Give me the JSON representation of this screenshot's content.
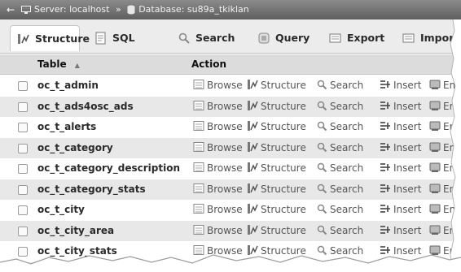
{
  "breadcrumb": {
    "back_glyph": "←",
    "server_label": "Server: localhost",
    "separator": "»",
    "database_label": "Database: su89a_tkiklan"
  },
  "tabs": [
    {
      "label": "Structure",
      "icon": "structure-icon",
      "active": true
    },
    {
      "label": "SQL",
      "icon": "sql-icon",
      "active": false
    },
    {
      "label": "Search",
      "icon": "search-icon",
      "active": false
    },
    {
      "label": "Query",
      "icon": "query-icon",
      "active": false
    },
    {
      "label": "Export",
      "icon": "export-icon",
      "active": false
    },
    {
      "label": "Import",
      "icon": "import-icon",
      "active": false
    }
  ],
  "table": {
    "headers": {
      "table": "Table",
      "sort_glyph": "▲",
      "action": "Action"
    },
    "actions": {
      "browse": "Browse",
      "structure": "Structure",
      "search": "Search",
      "insert": "Insert",
      "empty": "Empty"
    },
    "rows": [
      {
        "name": "oc_t_admin"
      },
      {
        "name": "oc_t_ads4osc_ads"
      },
      {
        "name": "oc_t_alerts"
      },
      {
        "name": "oc_t_category"
      },
      {
        "name": "oc_t_category_description"
      },
      {
        "name": "oc_t_category_stats"
      },
      {
        "name": "oc_t_city"
      },
      {
        "name": "oc_t_city_area"
      },
      {
        "name": "oc_t_city_stats"
      },
      {
        "name": ""
      }
    ]
  },
  "colors": {
    "breadcrumb_bg": "#6f6f6f",
    "tabs_bg": "#ececec",
    "row_alt_bg": "#e8e8e8",
    "header_bg": "#dcdcdc"
  }
}
